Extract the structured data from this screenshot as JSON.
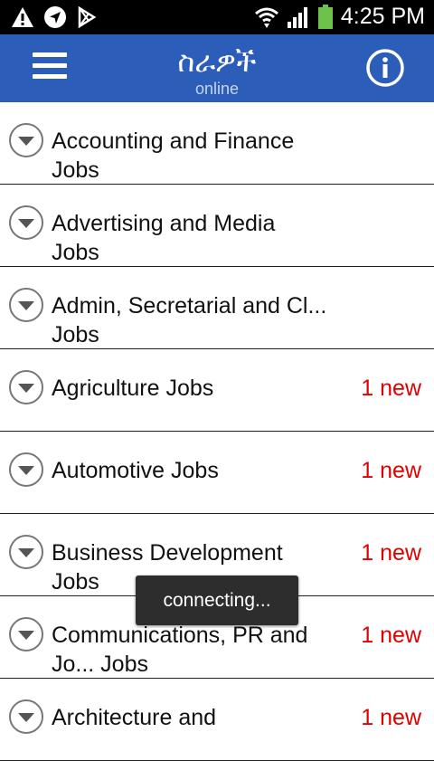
{
  "statusbar": {
    "time": "4:25 PM"
  },
  "appbar": {
    "title": "ስራዎች",
    "subtitle": "online"
  },
  "categories": [
    {
      "line1": "Accounting and Finance",
      "line2": "Jobs",
      "badge": ""
    },
    {
      "line1": "Advertising and Media",
      "line2": "Jobs",
      "badge": ""
    },
    {
      "line1": "Admin, Secretarial and Cl...",
      "line2": "Jobs",
      "badge": ""
    },
    {
      "line1": "Agriculture Jobs",
      "line2": "",
      "badge": "1 new"
    },
    {
      "line1": "Automotive Jobs",
      "line2": "",
      "badge": "1 new"
    },
    {
      "line1": "Business Development",
      "line2": "Jobs",
      "badge": "1 new"
    },
    {
      "line1": "Communications, PR and",
      "line2": "Jo... Jobs",
      "badge": "1 new"
    },
    {
      "line1": "Architecture and",
      "line2": "",
      "badge": "1 new"
    }
  ],
  "toast": {
    "text": "connecting..."
  },
  "colors": {
    "appbar": "#2c5db8",
    "badge": "#e00000",
    "statusbar": "#000000",
    "battery": "#6cc24a"
  },
  "icons": [
    "warning-icon",
    "navigation-icon",
    "play-store-icon",
    "wifi-icon",
    "signal-icon",
    "battery-icon",
    "menu-icon",
    "info-icon",
    "chevron-down-icon"
  ]
}
